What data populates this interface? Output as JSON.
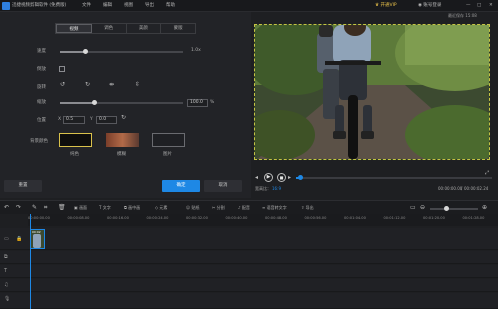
{
  "app": {
    "title": "迅捷视频剪辑软件 (免费版)",
    "menu": [
      "文件",
      "编辑",
      "视图",
      "导出",
      "帮助"
    ],
    "vip": "开通VIP",
    "login": "账号登录",
    "window_controls": [
      "—",
      "□",
      "✕"
    ],
    "corner_label": "最近保存 15:08"
  },
  "left_panel": {
    "tabs": [
      "视频",
      "调色",
      "美颜",
      "蒙版"
    ],
    "active_tab": "视频",
    "speed": {
      "label": "速度",
      "value": "1.0x",
      "level": 0.2
    },
    "reverse": {
      "label": "倒放"
    },
    "rotate": {
      "label": "旋转",
      "icons": [
        "rotate-left-icon",
        "rotate-right-icon",
        "flip-horizontal-icon",
        "flip-vertical-icon"
      ]
    },
    "scale": {
      "label": "缩放",
      "value": "100.0",
      "unit": "%",
      "level": 0.28
    },
    "position": {
      "label": "位置",
      "x_label": "X",
      "x_value": "0.5",
      "y_label": "Y",
      "y_value": "0.0"
    },
    "background": {
      "label": "背景颜色",
      "options": [
        "纯色",
        "模糊",
        "图片"
      ],
      "colors": [
        "#0d0d0d",
        "#8a4a2e",
        "#1f2024"
      ]
    },
    "reset_button": "重置",
    "ok_button": "确定",
    "cancel_button": "取消"
  },
  "preview": {
    "ratio_label": "宽高比：",
    "ratio_value": "16:9",
    "time_current": "00:00:00.00",
    "time_total": "00:00:02.24",
    "progress": 0.02
  },
  "timeline": {
    "tools": [
      "画面",
      "文字",
      "画中画",
      "元素",
      "贴纸",
      "分割",
      "配音",
      "语音转文字",
      "导出"
    ],
    "ruler": [
      "00:00:00.00",
      "00:00:08.00",
      "00:00:16.00",
      "00:00:24.00",
      "00:00:32.00",
      "00:00:40.00",
      "00:00:48.00",
      "00:00:56.00",
      "00:01:04.00",
      "00:01:12.00",
      "00:01:20.00",
      "00:01:28.00"
    ],
    "clip_label": "00:02"
  },
  "colors": {
    "accent": "#1e88e5",
    "highlight": "#c5c544",
    "background": "#1e1f22"
  }
}
